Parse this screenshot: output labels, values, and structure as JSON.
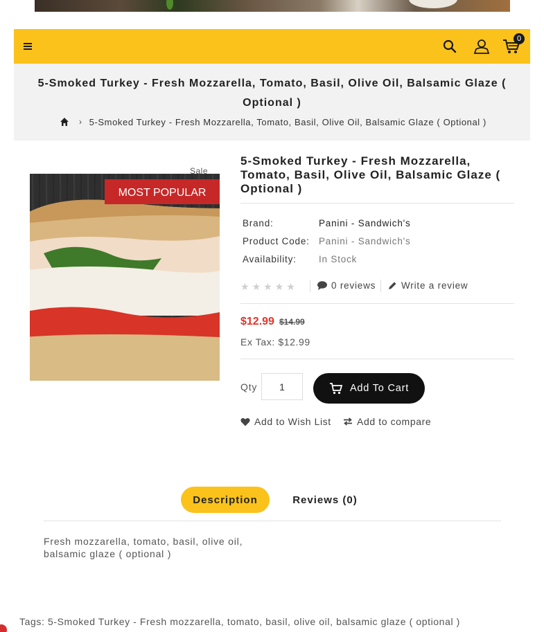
{
  "header": {
    "cart_count": "0"
  },
  "page": {
    "title": "5-Smoked Turkey - Fresh Mozzarella, Tomato, Basil, Olive Oil, Balsamic Glaze ( Optional )",
    "breadcrumb_current": "5-Smoked Turkey - Fresh Mozzarella, Tomato, Basil, Olive Oil, Balsamic Glaze ( Optional )"
  },
  "product": {
    "sale_label": "Sale",
    "image_badge": "MOST POPULAR",
    "title": "5-Smoked Turkey - Fresh Mozzarella, Tomato, Basil, Olive Oil, Balsamic Glaze ( Optional )",
    "brand_label": "Brand:",
    "brand_value": "Panini - Sandwich's",
    "code_label": "Product Code:",
    "code_value": "Panini - Sandwich's",
    "availability_label": "Availability:",
    "availability_value": "In Stock",
    "rating": 0,
    "reviews_link": "0 reviews",
    "write_review": "Write a review",
    "price": "$12.99",
    "old_price": "$14.99",
    "ex_tax": "Ex Tax: $12.99",
    "qty_label": "Qty",
    "qty_value": "1",
    "add_to_cart": "Add To Cart",
    "wishlist": "Add to Wish List",
    "compare": "Add to compare"
  },
  "tabs": {
    "description": "Description",
    "reviews": "Reviews (0)"
  },
  "description": {
    "text": "Fresh mozzarella, tomato, basil, olive oil, balsamic glaze ( optional )"
  },
  "tags": {
    "label": "Tags:",
    "value": "5-Smoked Turkey - Fresh mozzarella, tomato, basil, olive oil, balsamic glaze ( optional )"
  },
  "colors": {
    "accent": "#fbc21b",
    "price": "#e0352b",
    "button": "#111111"
  }
}
